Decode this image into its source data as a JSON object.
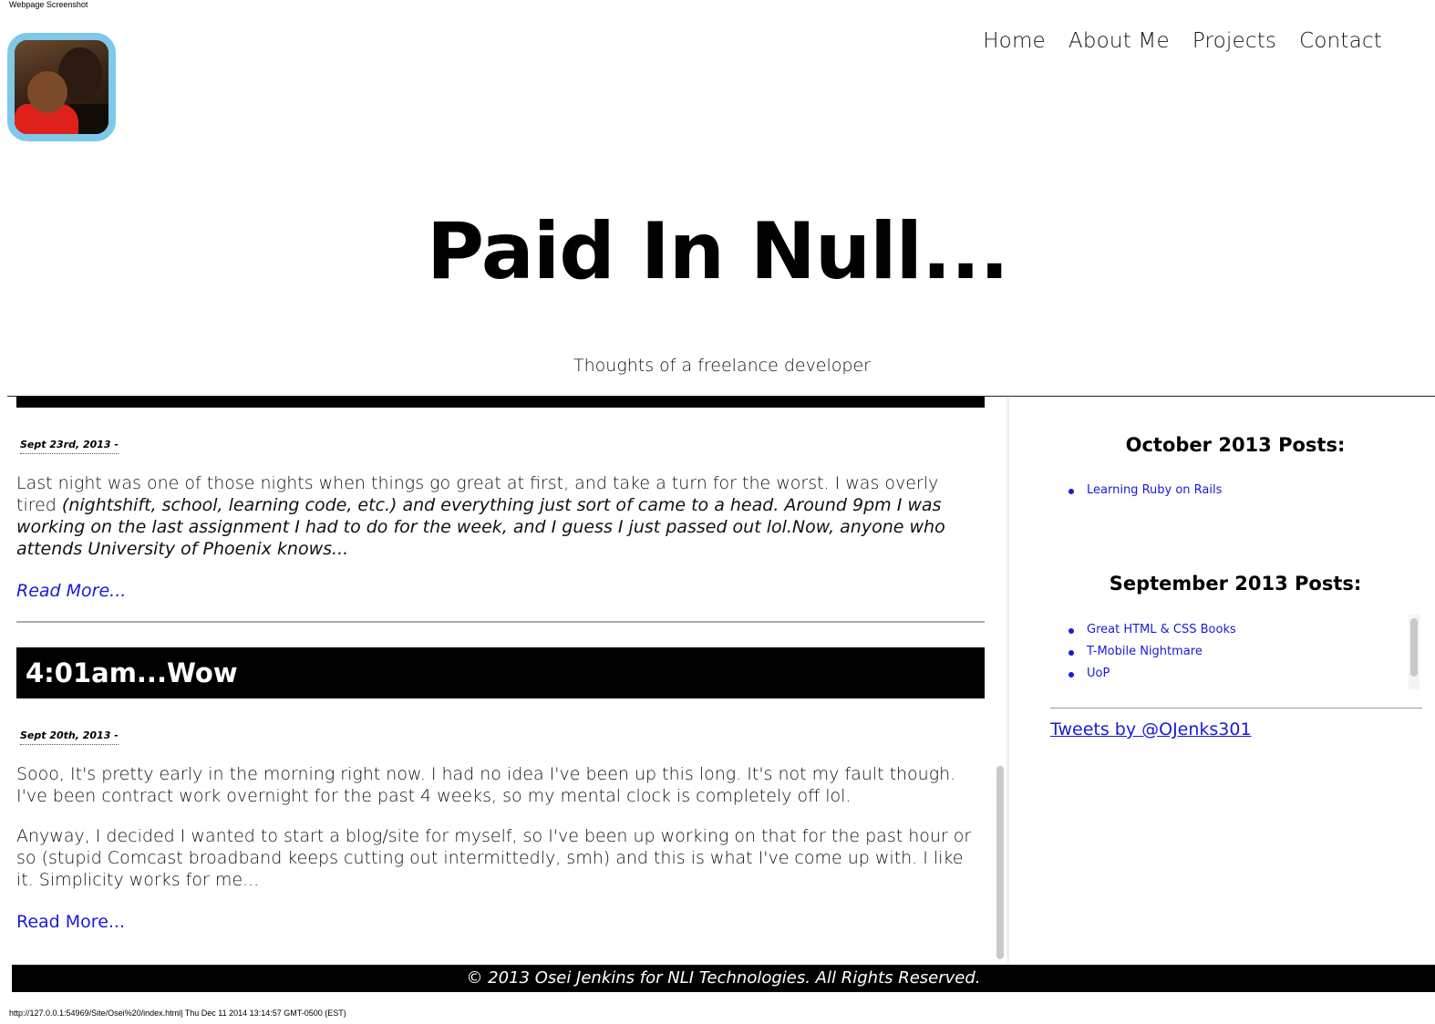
{
  "print": {
    "header": "Webpage Screenshot",
    "footer": "http://127.0.0.1:54969/Site/Osei%20/index.html| Thu Dec 11 2014 13:14:57 GMT-0500 (EST)"
  },
  "nav": {
    "items": [
      "Home",
      "About Me",
      "Projects",
      "Contact"
    ]
  },
  "site": {
    "title": "Paid In Null...",
    "tagline": "Thoughts of a freelance developer"
  },
  "posts": [
    {
      "date": "Sept 23rd, 2013 -",
      "body_normal": "Last night was one of those nights when things go great at first, and take a turn for the worst. I was overly tired ",
      "body_italic": "(nightshift, school, learning code, etc.) and everything just sort of came to a head. Around 9pm I was working on the last assignment I had to do for the week, and I guess I just passed out lol.Now, anyone who attends University of Phoenix knows...",
      "read_more": "Read More..."
    },
    {
      "title": "4:01am...Wow",
      "date": "Sept 20th, 2013 -",
      "para1": "Sooo, It's pretty early in the morning right now. I had no idea I've been up this long. It's not my fault though. I've been contract work overnight for the past 4 weeks, so my mental clock is completely off lol.",
      "para2": "Anyway, I decided I wanted to start a blog/site for myself, so I've been up working on that for the past hour or so (stupid Comcast broadband keeps cutting out intermittedly, smh) and this is what I've come up with. I like it. Simplicity works for me...",
      "read_more": "Read More..."
    }
  ],
  "sidebar": {
    "october": {
      "heading": "October 2013 Posts:",
      "items": [
        "Learning Ruby on Rails"
      ]
    },
    "september": {
      "heading": "September 2013 Posts:",
      "items": [
        "Great HTML & CSS Books",
        "T-Mobile Nightmare",
        "UoP"
      ]
    },
    "tweets_link": "Tweets by @OJenks301"
  },
  "footer": {
    "text": "© 2013 Osei Jenkins for NLI Technologies. All Rights Reserved."
  },
  "colors": {
    "avatar_border": "#7ec8e8",
    "link": "#1a1ad8",
    "bar": "#000000"
  }
}
